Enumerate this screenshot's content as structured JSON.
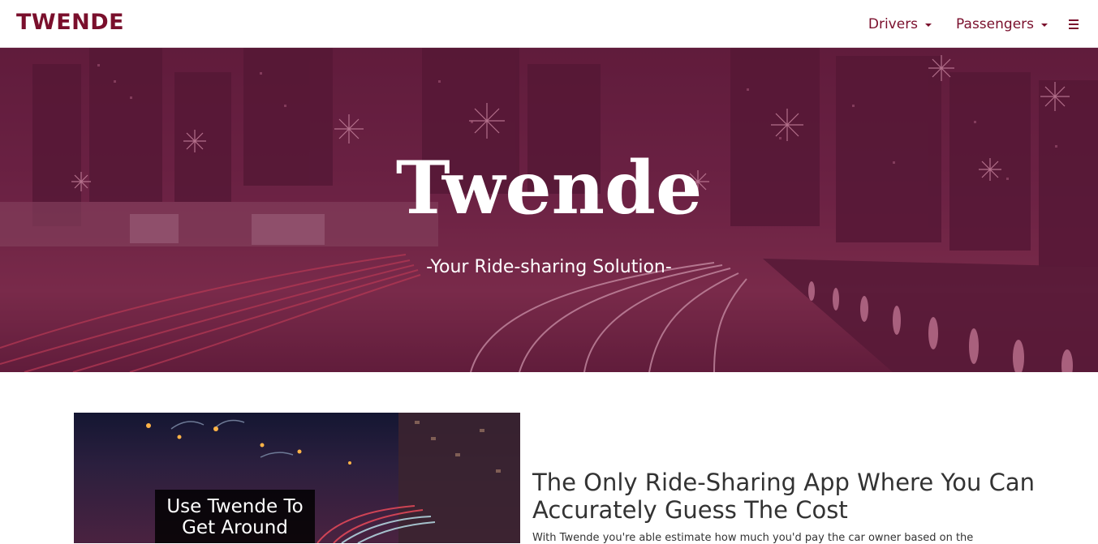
{
  "navbar": {
    "brand": "TWENDE",
    "items": [
      {
        "label": "Drivers"
      },
      {
        "label": "Passengers"
      }
    ],
    "menu_icon": "hamburger-icon"
  },
  "hero": {
    "title": "Twende",
    "subtitle": "-Your Ride-sharing Solution-"
  },
  "feature": {
    "image_caption": "Use Twende To Get Around",
    "title": "The Only Ride-Sharing App Where You Can Accurately Guess The Cost",
    "text": "With Twende you're able estimate how much you'd pay the car owner based on the"
  },
  "colors": {
    "brand": "#7a0f2c",
    "hero_tint": "#6b2545"
  }
}
